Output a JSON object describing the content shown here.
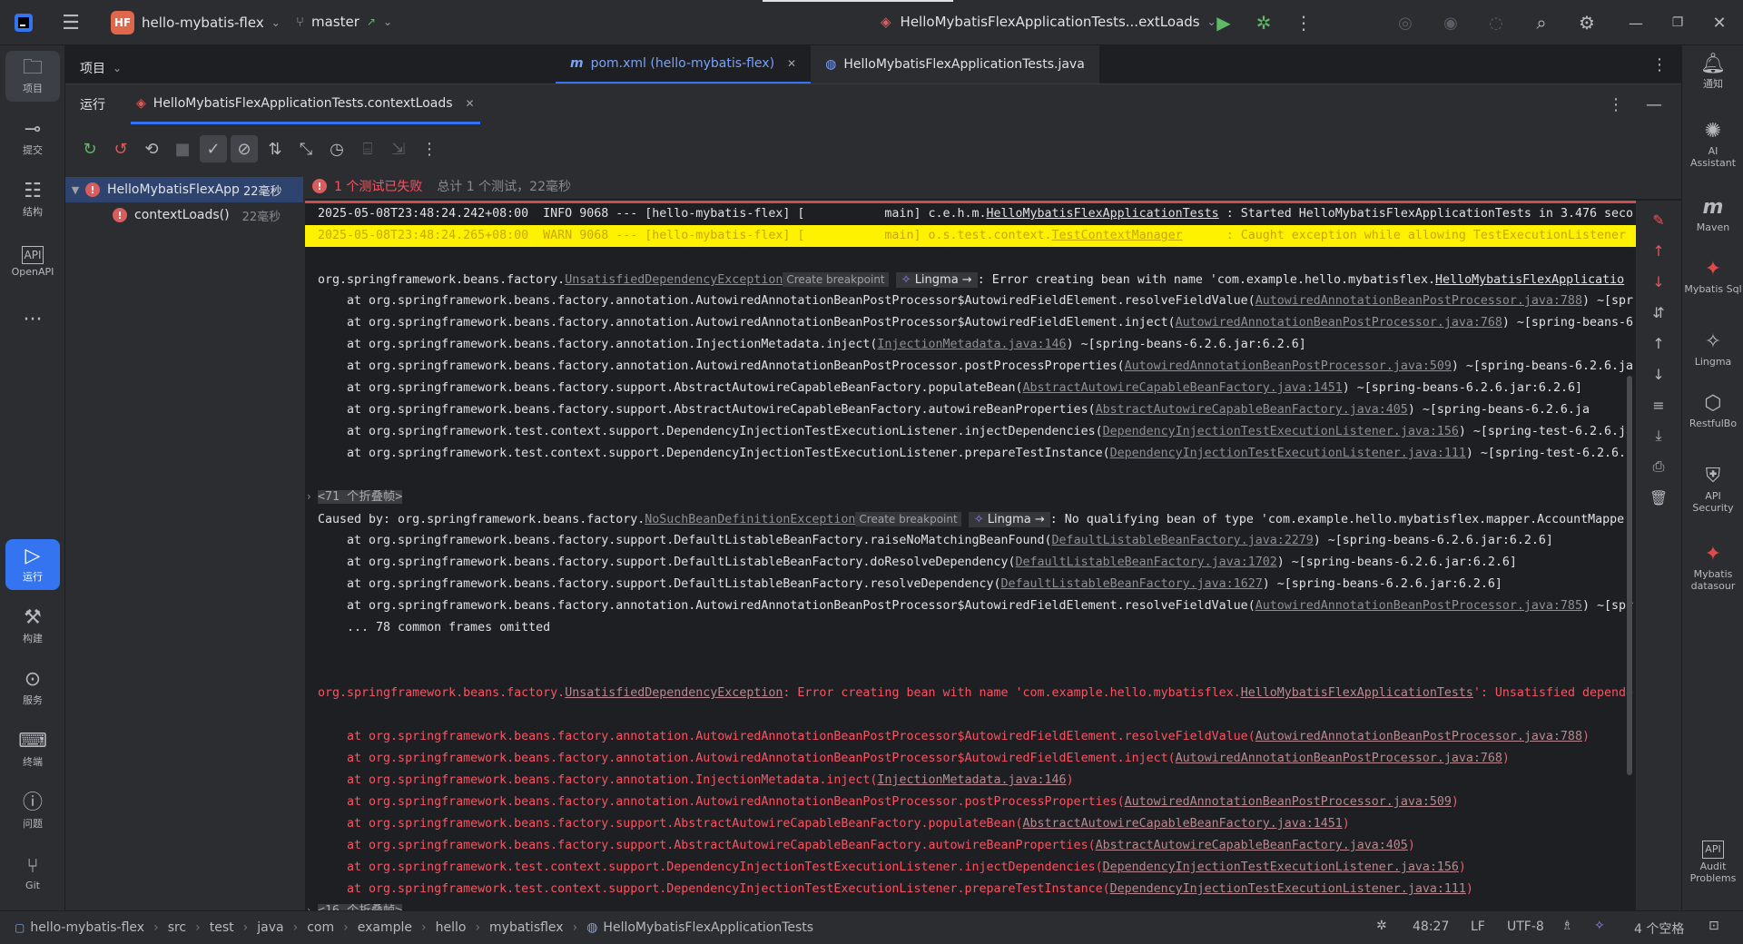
{
  "titlebar": {
    "project_badge": "HF",
    "project_name": "hello-mybatis-flex",
    "branch": "master",
    "run_config": "HelloMybatisFlexApplicationTests...extLoads"
  },
  "left_toolbar": {
    "items": [
      {
        "label": "项目"
      },
      {
        "label": "提交"
      },
      {
        "label": "结构"
      },
      {
        "label": "OpenAPI"
      },
      {
        "label": "运行"
      },
      {
        "label": "构建"
      },
      {
        "label": "服务"
      },
      {
        "label": "终端"
      },
      {
        "label": "问题"
      },
      {
        "label": "Git"
      }
    ]
  },
  "right_toolbar": {
    "items": [
      {
        "label": "通知"
      },
      {
        "label": "AI Assistant"
      },
      {
        "label": "Maven"
      },
      {
        "label": "Mybatis Sql"
      },
      {
        "label": "Lingma"
      },
      {
        "label": "RestfulBo"
      },
      {
        "label": "API Security"
      },
      {
        "label": "Mybatis datasour"
      },
      {
        "label": "Audit Problems"
      }
    ]
  },
  "project_panel": {
    "title": "项目"
  },
  "editor_tabs": [
    {
      "label": "pom.xml (hello-mybatis-flex)"
    },
    {
      "label": "HelloMybatisFlexApplicationTests.java"
    }
  ],
  "run_panel": {
    "title": "运行",
    "tab_label": "HelloMybatisFlexApplicationTests.contextLoads"
  },
  "test_tree": [
    {
      "name": "HelloMybatisFlexApp",
      "time": "22毫秒"
    },
    {
      "name": "contextLoads()",
      "time": "22毫秒"
    }
  ],
  "test_status": {
    "failed": "1 个测试已失败",
    "summary": "总计 1 个测试，22毫秒"
  },
  "console": {
    "line1_prefix": "2025-05-08T23:48:24.242+08:00  INFO 9068 --- [hello-mybatis-flex] [           main] c.e.h.m.",
    "line1_link": "HelloMybatisFlexApplicationTests",
    "line1_suffix": " : Started HelloMybatisFlexApplicationTests in 3.476 seco",
    "line2_prefix": "2025-05-08T23:48:24.265+08:00  WARN 9068 --- [hello-mybatis-flex] [           main] o.s.test.context.",
    "line2_link": "TestContextManager",
    "line2_suffix": "      : Caught exception while allowing TestExecutionListener",
    "exc1_prefix": "org.springframework.beans.factory.",
    "exc1_link": "UnsatisfiedDependencyException",
    "breakpoint": "Create breakpoint",
    "lingma": "Lingma →",
    "exc1_suffix": ": Error creating bean with name 'com.example.hello.mybatisflex.",
    "exc1_link2": "HelloMybatisFlexApplicatio",
    "stack1": [
      {
        "pre": "    at org.springframework.beans.factory.annotation.AutowiredAnnotationBeanPostProcessor$AutowiredFieldElement.resolveFieldValue(",
        "link": "AutowiredAnnotationBeanPostProcessor.java:788",
        "post": ") ~[spr"
      },
      {
        "pre": "    at org.springframework.beans.factory.annotation.AutowiredAnnotationBeanPostProcessor$AutowiredFieldElement.inject(",
        "link": "AutowiredAnnotationBeanPostProcessor.java:768",
        "post": ") ~[spring-beans-6"
      },
      {
        "pre": "    at org.springframework.beans.factory.annotation.InjectionMetadata.inject(",
        "link": "InjectionMetadata.java:146",
        "post": ") ~[spring-beans-6.2.6.jar:6.2.6]"
      },
      {
        "pre": "    at org.springframework.beans.factory.annotation.AutowiredAnnotationBeanPostProcessor.postProcessProperties(",
        "link": "AutowiredAnnotationBeanPostProcessor.java:509",
        "post": ") ~[spring-beans-6.2.6.ja"
      },
      {
        "pre": "    at org.springframework.beans.factory.support.AbstractAutowireCapableBeanFactory.populateBean(",
        "link": "AbstractAutowireCapableBeanFactory.java:1451",
        "post": ") ~[spring-beans-6.2.6.jar:6.2.6]"
      },
      {
        "pre": "    at org.springframework.beans.factory.support.AbstractAutowireCapableBeanFactory.autowireBeanProperties(",
        "link": "AbstractAutowireCapableBeanFactory.java:405",
        "post": ") ~[spring-beans-6.2.6.ja"
      },
      {
        "pre": "    at org.springframework.test.context.support.DependencyInjectionTestExecutionListener.injectDependencies(",
        "link": "DependencyInjectionTestExecutionListener.java:156",
        "post": ") ~[spring-test-6.2.6.ja"
      },
      {
        "pre": "    at org.springframework.test.context.support.DependencyInjectionTestExecutionListener.prepareTestInstance(",
        "link": "DependencyInjectionTestExecutionListener.java:111",
        "post": ") ~[spring-test-6.2.6.j"
      }
    ],
    "fold1": "<71 个折叠帧>",
    "caused_prefix": "Caused by: org.springframework.beans.factory.",
    "caused_link": "NoSuchBeanDefinitionException",
    "caused_suffix": ": No qualifying bean of type 'com.example.hello.mybatisflex.mapper.AccountMappe",
    "stack2": [
      {
        "pre": "    at org.springframework.beans.factory.support.DefaultListableBeanFactory.raiseNoMatchingBeanFound(",
        "link": "DefaultListableBeanFactory.java:2279",
        "post": ") ~[spring-beans-6.2.6.jar:6.2.6]"
      },
      {
        "pre": "    at org.springframework.beans.factory.support.DefaultListableBeanFactory.doResolveDependency(",
        "link": "DefaultListableBeanFactory.java:1702",
        "post": ") ~[spring-beans-6.2.6.jar:6.2.6]"
      },
      {
        "pre": "    at org.springframework.beans.factory.support.DefaultListableBeanFactory.resolveDependency(",
        "link": "DefaultListableBeanFactory.java:1627",
        "post": ") ~[spring-beans-6.2.6.jar:6.2.6]"
      },
      {
        "pre": "    at org.springframework.beans.factory.annotation.AutowiredAnnotationBeanPostProcessor$AutowiredFieldElement.resolveFieldValue(",
        "link": "AutowiredAnnotationBeanPostProcessor.java:785",
        "post": ") ~[spr"
      }
    ],
    "omitted": "    ... 78 common frames omitted",
    "exc2_prefix": "org.springframework.beans.factory.",
    "exc2_link": "UnsatisfiedDependencyException",
    "exc2_suffix": ": Error creating bean with name 'com.example.hello.mybatisflex.",
    "exc2_link2": "HelloMybatisFlexApplicationTests",
    "exc2_tail": "': Unsatisfied depende",
    "stack3": [
      {
        "pre": "    at org.springframework.beans.factory.annotation.AutowiredAnnotationBeanPostProcessor$AutowiredFieldElement.resolveFieldValue(",
        "link": "AutowiredAnnotationBeanPostProcessor.java:788",
        "post": ")"
      },
      {
        "pre": "    at org.springframework.beans.factory.annotation.AutowiredAnnotationBeanPostProcessor$AutowiredFieldElement.inject(",
        "link": "AutowiredAnnotationBeanPostProcessor.java:768",
        "post": ")"
      },
      {
        "pre": "    at org.springframework.beans.factory.annotation.InjectionMetadata.inject(",
        "link": "InjectionMetadata.java:146",
        "post": ")"
      },
      {
        "pre": "    at org.springframework.beans.factory.annotation.AutowiredAnnotationBeanPostProcessor.postProcessProperties(",
        "link": "AutowiredAnnotationBeanPostProcessor.java:509",
        "post": ")"
      },
      {
        "pre": "    at org.springframework.beans.factory.support.AbstractAutowireCapableBeanFactory.populateBean(",
        "link": "AbstractAutowireCapableBeanFactory.java:1451",
        "post": ")"
      },
      {
        "pre": "    at org.springframework.beans.factory.support.AbstractAutowireCapableBeanFactory.autowireBeanProperties(",
        "link": "AbstractAutowireCapableBeanFactory.java:405",
        "post": ")"
      },
      {
        "pre": "    at org.springframework.test.context.support.DependencyInjectionTestExecutionListener.injectDependencies(",
        "link": "DependencyInjectionTestExecutionListener.java:156",
        "post": ")"
      },
      {
        "pre": "    at org.springframework.test.context.support.DependencyInjectionTestExecutionListener.prepareTestInstance(",
        "link": "DependencyInjectionTestExecutionListener.java:111",
        "post": ")"
      }
    ],
    "fold2": "<16 个折叠帧>"
  },
  "statusbar": {
    "crumbs": [
      "hello-mybatis-flex",
      "src",
      "test",
      "java",
      "com",
      "example",
      "hello",
      "mybatisflex",
      "HelloMybatisFlexApplicationTests"
    ],
    "position": "48:27",
    "line_sep": "LF",
    "encoding": "UTF-8",
    "indent": "4 个空格"
  }
}
